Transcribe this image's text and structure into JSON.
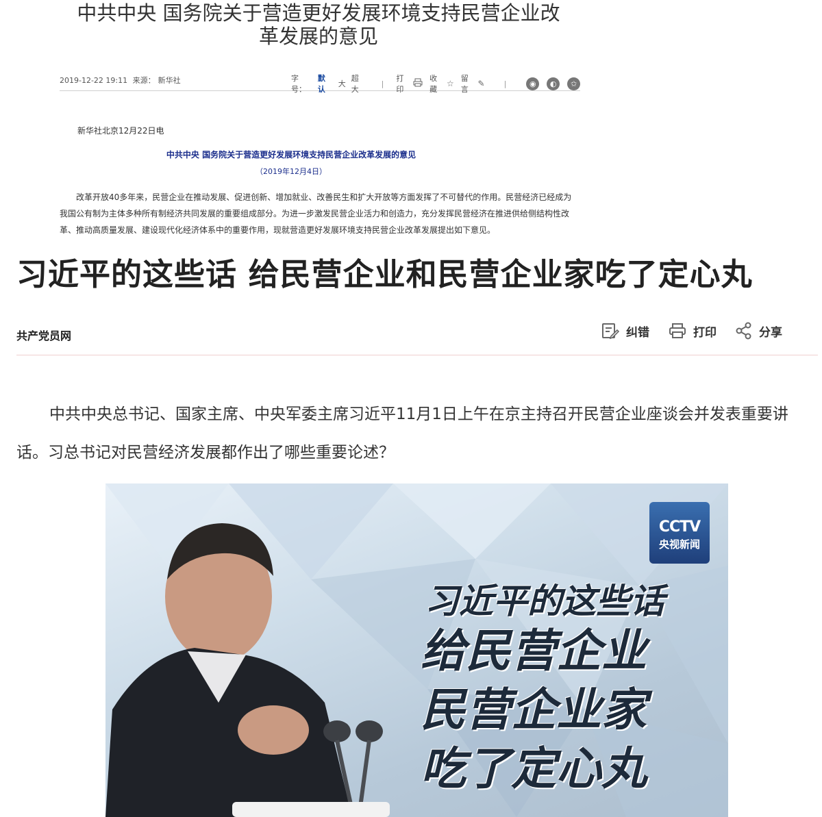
{
  "top_article": {
    "title_line1": "中共中央 国务院关于营造更好发展环境支持民营企业改",
    "title_line2": "革发展的意见",
    "meta": {
      "datetime": "2019-12-22 19:11",
      "source_label": "来源：",
      "source": "新华社",
      "font_size_label": "字号：",
      "sizes": [
        "默认",
        "大",
        "超大"
      ],
      "print_label": "打印",
      "collect_label": "收藏",
      "comment_label": "留言",
      "share_icons": [
        "weibo-icon",
        "wechat-icon",
        "favorite-star-icon"
      ]
    },
    "dateline": "新华社北京12月22日电",
    "doc_title": "中共中央  国务院关于营造更好发展环境支持民营企业改革发展的意见",
    "doc_date": "（2019年12月4日）",
    "paragraph": "改革开放40多年来，民营企业在推动发展、促进创新、增加就业、改善民生和扩大开放等方面发挥了不可替代的作用。民营经济已经成为我国公有制为主体多种所有制经济共同发展的重要组成部分。为进一步激发民营企业活力和创造力，充分发挥民营经济在推进供给侧结构性改革、推动高质量发展、建设现代化经济体系中的重要作用，现就营造更好发展环境支持民营企业改革发展提出如下意见。"
  },
  "second_article": {
    "title": "习近平的这些话 给民营企业和民营企业家吃了定心丸",
    "source": "共产党员网",
    "tools": {
      "correct_label": "纠错",
      "print_label": "打印",
      "share_label": "分享"
    },
    "body": "中共中央总书记、国家主席、中央军委主席习近平11月1日上午在京主持召开民营企业座谈会并发表重要讲话。习总书记对民营经济发展都作出了哪些重要论述？",
    "image": {
      "logo_line1": "CCTV",
      "logo_line2": "央视新闻",
      "slogan": [
        "习近平的这些话",
        "给民营企业",
        "民营企业家",
        "吃了定心丸"
      ]
    }
  },
  "colors": {
    "link_blue": "#1b2e8c",
    "active_size": "#1a4aa0",
    "divider": "#f0cfcf"
  }
}
